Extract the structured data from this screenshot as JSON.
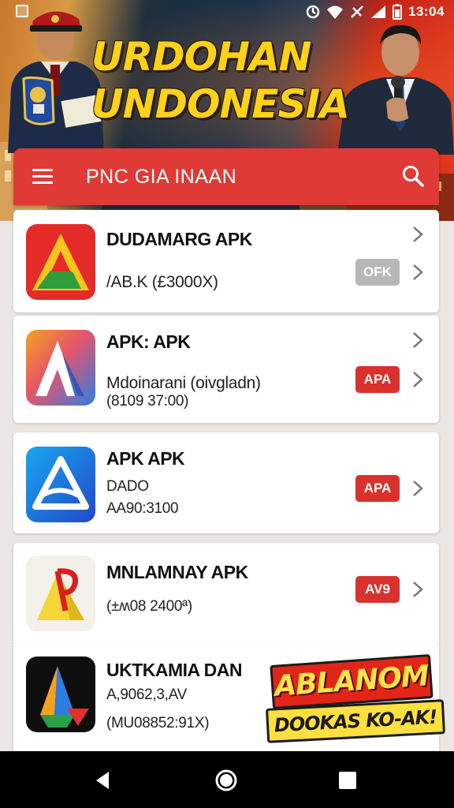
{
  "status_bar": {
    "time": "13:04",
    "icons": [
      "notification-icon",
      "sync-icon",
      "wifi-icon",
      "signal-off-icon",
      "cell-signal-icon",
      "battery-icon"
    ]
  },
  "hero": {
    "title_line1": "URDOHAN",
    "title_line2": "UNDONESIA"
  },
  "app_bar": {
    "title": "PNC GIA INAAN",
    "color": "#e03a36"
  },
  "items": [
    {
      "title": "DUDAMARG APK",
      "line1": "",
      "line2": "/AB.K (£3000X)",
      "badge": "OFK",
      "badge_color": "grey",
      "icon": "triangle-a-red-icon"
    },
    {
      "title": "APK: APK",
      "line1": "Mdoinarani (oivgladn)",
      "line2": "(8109 37:00)",
      "badge": "APA",
      "badge_color": "red",
      "icon": "gradient-a-icon"
    },
    {
      "title": "APK APK",
      "line1": "DADO",
      "line2": "AA90:3100",
      "badge": "APA",
      "badge_color": "red",
      "icon": "blue-a-icon"
    },
    {
      "title": "MNLAMNAY APK",
      "line1": "",
      "line2": "(±ʍ08 2400ª)",
      "badge": "AV9",
      "badge_color": "red",
      "icon": "p-logo-icon"
    },
    {
      "title": "UKTKAMIA DAN",
      "line1": "A,9062,3,AV",
      "line2": "(MU08852:91X)",
      "badge": "",
      "badge_color": "",
      "icon": "dark-a-icon"
    }
  ],
  "promo": {
    "line1": "ABLANOM",
    "line2": "DOOKAS KO-AK!"
  },
  "nav": {
    "icons": [
      "back-icon",
      "home-icon",
      "recents-icon"
    ]
  }
}
